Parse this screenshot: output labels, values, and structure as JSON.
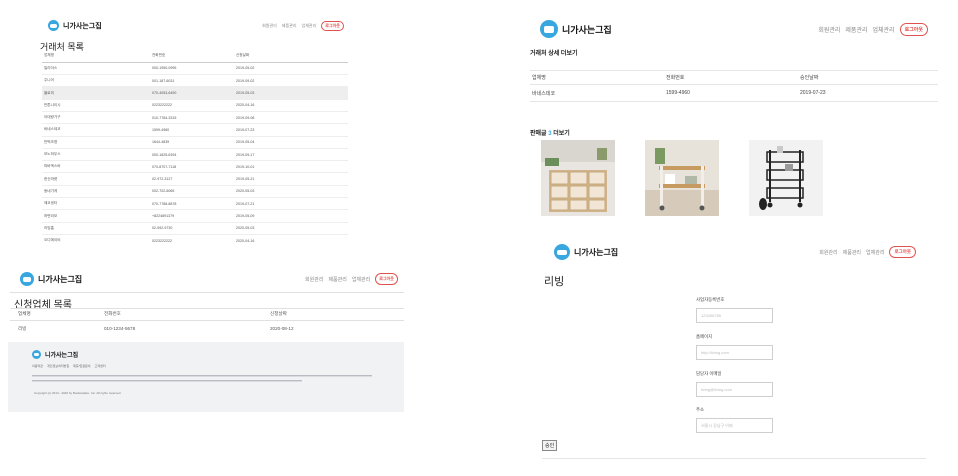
{
  "brand": {
    "name": "니가사는그집",
    "accent": "#38a7e0",
    "logout_color": "#e0524f"
  },
  "nav": {
    "members": "회원관리",
    "products": "제품관리",
    "companies": "업체관리",
    "logout": "로그아웃"
  },
  "company_list": {
    "title": "거래처 목록",
    "columns": [
      "업체명",
      "전화번호",
      "신청날짜"
    ],
    "rows": [
      [
        "일리아스",
        "000-1950-0995",
        "2019-05-02"
      ],
      [
        "주니어",
        "001-187-6031",
        "2019-09-02"
      ],
      [
        "블로미",
        "070-4053-6490",
        "2019-05-03"
      ],
      [
        "반톤나이시",
        "0223222222",
        "2020-04-16"
      ],
      [
        "아데랑가구",
        "010-7784-3315",
        "2019-09-08"
      ],
      [
        "바네스데코",
        "1599-4960",
        "2019-07-23"
      ],
      [
        "반벅조명",
        "1644-4839",
        "2019-05-04"
      ],
      [
        "모노하우스",
        "000-1625-6394",
        "2019-09-17"
      ],
      [
        "마바엑스바",
        "070-8707-7118",
        "2019-10-01"
      ],
      [
        "한신마켓",
        "02-972-3127",
        "2019-05-21"
      ],
      [
        "동네가게",
        "002-702-6065",
        "2020-05-03"
      ],
      [
        "에코센터",
        "070-7788-8878",
        "2019-07-21"
      ],
      [
        "하면리모",
        "+8224891379",
        "2019-05-09"
      ],
      [
        "리빙홈",
        "02-592-9730",
        "2020-05-03"
      ],
      [
        "오디에이비",
        "0223222222",
        "2020-04-16"
      ]
    ]
  },
  "detail": {
    "title": "거래처 상세 더보기",
    "columns": [
      "업체명",
      "전화번호",
      "승인날짜"
    ],
    "row": [
      "바네스데코",
      "1599-4960",
      "2019-07-23"
    ],
    "products_prefix": "판매글",
    "products_count": "3",
    "products_suffix": "더보기"
  },
  "applicants": {
    "title": "신청업체 목록",
    "columns": [
      "업체명",
      "전화번호",
      "신청날짜"
    ],
    "row": [
      "리빙",
      "010-1234-5678",
      "2020-08-12"
    ],
    "footer": {
      "links": [
        "이용약관",
        "개인정보처리방침",
        "제휴/입점문의",
        "고객센터"
      ],
      "copyright": "Copyright (c) 2014 - 2020 by Bucketplace, Inc. All rights reserved."
    }
  },
  "living_form": {
    "title": "리빙",
    "fields": [
      {
        "label": "사업자등록번호",
        "placeholder": "123456789"
      },
      {
        "label": "홈페이지",
        "placeholder": "http://living.com"
      },
      {
        "label": "담당자 이메일",
        "placeholder": "living@living.com"
      },
      {
        "label": "주소",
        "placeholder": "서울시 강남구 어쩌"
      }
    ],
    "approve": "승인"
  }
}
